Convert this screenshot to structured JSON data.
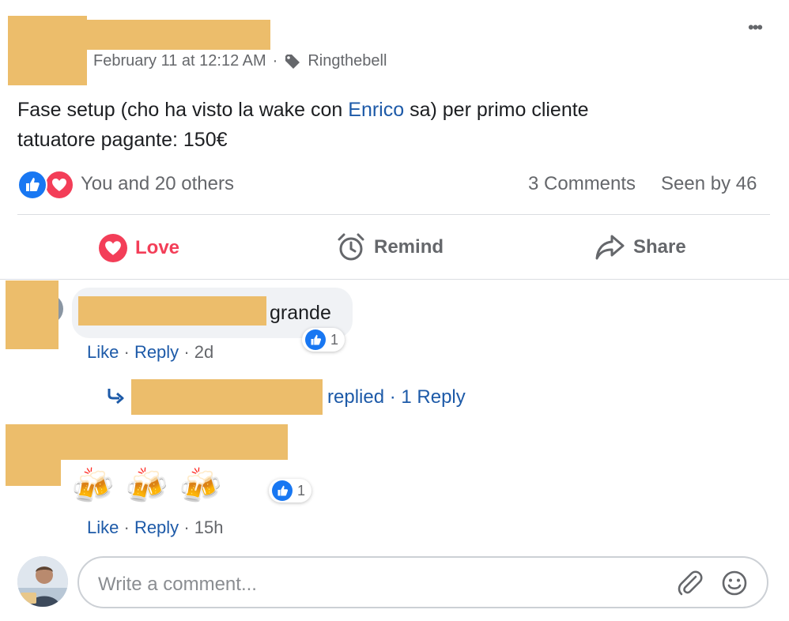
{
  "post": {
    "timestamp": "February 11 at 12:12 AM",
    "separator": "·",
    "tag_name": "Ringthebell",
    "menu_glyph": "•••",
    "text_before": "Fase setup (cho ha visto la wake con ",
    "mention": "Enrico",
    "text_after": " sa) per primo cliente",
    "text_line2": "tatuatore pagante: 150€",
    "reactions_summary": "You and 20 others",
    "comments_count": "3 Comments",
    "seen_by": "Seen by 46"
  },
  "actions": {
    "love": "Love",
    "remind": "Remind",
    "share": "Share"
  },
  "comments": [
    {
      "text": "grande",
      "like_label": "Like",
      "reply_label": "Reply",
      "time": "2d",
      "reaction_count": "1",
      "replies_text": "replied",
      "replies_link": "1 Reply"
    },
    {
      "emoji": "🍻",
      "like_label": "Like",
      "reply_label": "Reply",
      "time": "15h",
      "reaction_count": "1"
    }
  ],
  "composer": {
    "placeholder": "Write a comment..."
  },
  "colors": {
    "redaction": "#ecbd6b",
    "like_blue": "#1877f2",
    "love_red": "#f33e58",
    "link_blue": "#1d5aa8",
    "meta_gray": "#65676b"
  },
  "icons": {
    "menu": "more-icon",
    "tag": "tag-icon",
    "like": "like-icon",
    "love": "heart-icon",
    "remind": "alarm-clock-icon",
    "share": "share-arrow-icon",
    "reply": "reply-arrow-icon",
    "attach": "paperclip-icon",
    "emoji": "smiley-icon"
  }
}
